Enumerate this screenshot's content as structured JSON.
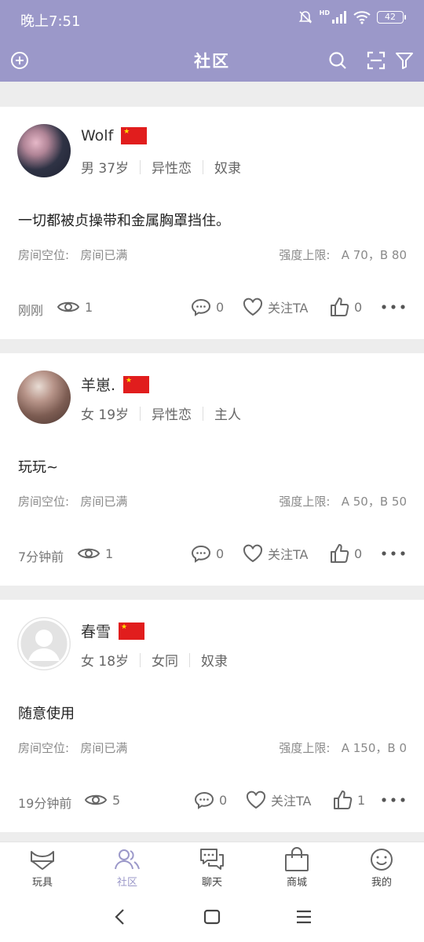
{
  "status_bar": {
    "time": "晚上7:51",
    "network": "HD",
    "battery": "42"
  },
  "header": {
    "title": "社区",
    "icons": [
      "add-circle-icon",
      "search-icon",
      "scan-icon",
      "filter-icon"
    ]
  },
  "posts": [
    {
      "username": "Wolf",
      "gender_age": "男 37岁",
      "orientation": "异性恋",
      "role": "奴隶",
      "content": "一切都被贞操带和金属胸罩挡住。",
      "room_label": "房间空位:",
      "room_status": "房间已满",
      "limit_label": "强度上限:",
      "limit_value": "A 70，B 80",
      "time_ago": "刚刚",
      "views": "1",
      "comments": "0",
      "follow_label": "关注TA",
      "likes": "0"
    },
    {
      "username": "羊崽.",
      "gender_age": "女 19岁",
      "orientation": "异性恋",
      "role": "主人",
      "content": "玩玩~",
      "room_label": "房间空位:",
      "room_status": "房间已满",
      "limit_label": "强度上限:",
      "limit_value": "A 50，B 50",
      "time_ago": "7分钟前",
      "views": "1",
      "comments": "0",
      "follow_label": "关注TA",
      "likes": "0"
    },
    {
      "username": "春雪",
      "gender_age": "女 18岁",
      "orientation": "女同",
      "role": "奴隶",
      "content": "随意使用",
      "room_label": "房间空位:",
      "room_status": "房间已满",
      "limit_label": "强度上限:",
      "limit_value": "A 150，B 0",
      "time_ago": "19分钟前",
      "views": "5",
      "comments": "0",
      "follow_label": "关注TA",
      "likes": "1"
    }
  ],
  "tabbar": {
    "items": [
      {
        "label": "玩具",
        "icon": "toy-icon"
      },
      {
        "label": "社区",
        "icon": "community-icon",
        "active": true
      },
      {
        "label": "聊天",
        "icon": "chat-icon"
      },
      {
        "label": "商城",
        "icon": "shop-bag-icon"
      },
      {
        "label": "我的",
        "icon": "profile-smile-icon"
      }
    ]
  },
  "colors": {
    "accent": "#9b98c9",
    "background": "#ededed",
    "flag_red": "#e11d1d"
  }
}
